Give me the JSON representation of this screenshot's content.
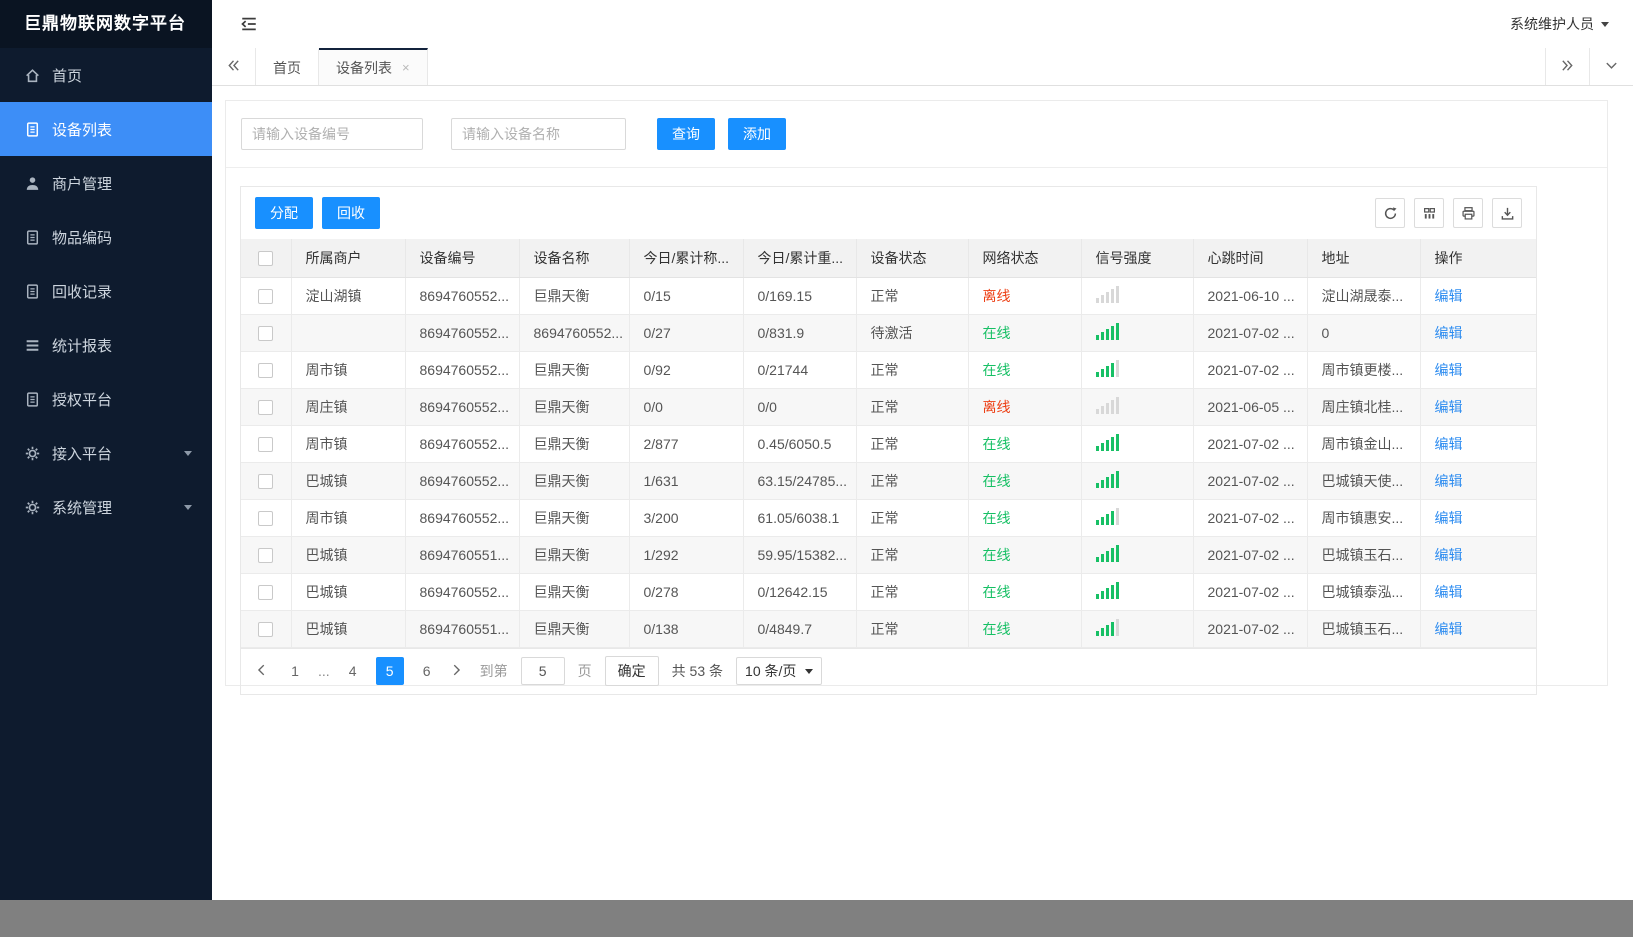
{
  "colors": {
    "accent": "#1890ff",
    "sidebar_active": "#3d8ef7",
    "online_green": "#17c065",
    "offline_red": "#ed3f14",
    "link_blue": "#2d8cf0"
  },
  "sidebar": {
    "title": "巨鼎物联网数字平台",
    "items": [
      {
        "key": "home",
        "label": "首页",
        "icon": "home-icon",
        "active": false,
        "has_submenu": false
      },
      {
        "key": "device-list",
        "label": "设备列表",
        "icon": "document-icon",
        "active": true,
        "has_submenu": false
      },
      {
        "key": "merchant-management",
        "label": "商户管理",
        "icon": "user-icon",
        "active": false,
        "has_submenu": false
      },
      {
        "key": "item-code",
        "label": "物品编码",
        "icon": "document-icon",
        "active": false,
        "has_submenu": false
      },
      {
        "key": "recycle-records",
        "label": "回收记录",
        "icon": "document-icon",
        "active": false,
        "has_submenu": false
      },
      {
        "key": "statistics-report",
        "label": "统计报表",
        "icon": "list-icon",
        "active": false,
        "has_submenu": false
      },
      {
        "key": "authorization-platform",
        "label": "授权平台",
        "icon": "document-icon",
        "active": false,
        "has_submenu": false
      },
      {
        "key": "access-platform",
        "label": "接入平台",
        "icon": "gear-icon",
        "active": false,
        "has_submenu": true
      },
      {
        "key": "system-management",
        "label": "系统管理",
        "icon": "gear-icon",
        "active": false,
        "has_submenu": true
      }
    ]
  },
  "topbar": {
    "user_name": "系统维护人员"
  },
  "tabs": {
    "items": [
      {
        "key": "home",
        "label": "首页",
        "active": false,
        "closable": false
      },
      {
        "key": "device-list",
        "label": "设备列表",
        "active": true,
        "closable": true
      }
    ],
    "close_glyph": "×"
  },
  "search": {
    "device_no_placeholder": "请输入设备编号",
    "device_name_placeholder": "请输入设备名称",
    "query_label": "查询",
    "add_label": "添加"
  },
  "toolbar": {
    "assign_label": "分配",
    "recycle_label": "回收",
    "icon_buttons": [
      "refresh-icon",
      "columns-icon",
      "print-icon",
      "export-icon"
    ]
  },
  "table": {
    "headers": [
      "所属商户",
      "设备编号",
      "设备名称",
      "今日/累计称...",
      "今日/累计重...",
      "设备状态",
      "网络状态",
      "信号强度",
      "心跳时间",
      "地址",
      "操作"
    ],
    "edit_label": "编辑",
    "rows": [
      {
        "merchant": "淀山湖镇",
        "device_no": "8694760552...",
        "device_name": "巨鼎天衡",
        "today_count": "0/15",
        "today_weight": "0/169.15",
        "device_status": "正常",
        "network_status": "离线",
        "online": false,
        "signal_level": 0,
        "heartbeat": "2021-06-10 ...",
        "address": "淀山湖晟泰...",
        "zebra": false
      },
      {
        "merchant": "",
        "device_no": "8694760552...",
        "device_name": "8694760552...",
        "today_count": "0/27",
        "today_weight": "0/831.9",
        "device_status": "待激活",
        "network_status": "在线",
        "online": true,
        "signal_level": 5,
        "heartbeat": "2021-07-02 ...",
        "address": "0",
        "zebra": true
      },
      {
        "merchant": "周市镇",
        "device_no": "8694760552...",
        "device_name": "巨鼎天衡",
        "today_count": "0/92",
        "today_weight": "0/21744",
        "device_status": "正常",
        "network_status": "在线",
        "online": true,
        "signal_level": 4,
        "heartbeat": "2021-07-02 ...",
        "address": "周市镇更楼...",
        "zebra": false
      },
      {
        "merchant": "周庄镇",
        "device_no": "8694760552...",
        "device_name": "巨鼎天衡",
        "today_count": "0/0",
        "today_weight": "0/0",
        "device_status": "正常",
        "network_status": "离线",
        "online": false,
        "signal_level": 0,
        "heartbeat": "2021-06-05 ...",
        "address": "周庄镇北桂...",
        "zebra": true
      },
      {
        "merchant": "周市镇",
        "device_no": "8694760552...",
        "device_name": "巨鼎天衡",
        "today_count": "2/877",
        "today_weight": "0.45/6050.5",
        "device_status": "正常",
        "network_status": "在线",
        "online": true,
        "signal_level": 5,
        "heartbeat": "2021-07-02 ...",
        "address": "周市镇金山...",
        "zebra": false
      },
      {
        "merchant": "巴城镇",
        "device_no": "8694760552...",
        "device_name": "巨鼎天衡",
        "today_count": "1/631",
        "today_weight": "63.15/24785...",
        "device_status": "正常",
        "network_status": "在线",
        "online": true,
        "signal_level": 5,
        "heartbeat": "2021-07-02 ...",
        "address": "巴城镇天使...",
        "zebra": true
      },
      {
        "merchant": "周市镇",
        "device_no": "8694760552...",
        "device_name": "巨鼎天衡",
        "today_count": "3/200",
        "today_weight": "61.05/6038.1",
        "device_status": "正常",
        "network_status": "在线",
        "online": true,
        "signal_level": 4,
        "heartbeat": "2021-07-02 ...",
        "address": "周市镇惠安...",
        "zebra": false
      },
      {
        "merchant": "巴城镇",
        "device_no": "8694760551...",
        "device_name": "巨鼎天衡",
        "today_count": "1/292",
        "today_weight": "59.95/15382...",
        "device_status": "正常",
        "network_status": "在线",
        "online": true,
        "signal_level": 5,
        "heartbeat": "2021-07-02 ...",
        "address": "巴城镇玉石...",
        "zebra": true
      },
      {
        "merchant": "巴城镇",
        "device_no": "8694760552...",
        "device_name": "巨鼎天衡",
        "today_count": "0/278",
        "today_weight": "0/12642.15",
        "device_status": "正常",
        "network_status": "在线",
        "online": true,
        "signal_level": 5,
        "heartbeat": "2021-07-02 ...",
        "address": "巴城镇泰泓...",
        "zebra": false
      },
      {
        "merchant": "巴城镇",
        "device_no": "8694760551...",
        "device_name": "巨鼎天衡",
        "today_count": "0/138",
        "today_weight": "0/4849.7",
        "device_status": "正常",
        "network_status": "在线",
        "online": true,
        "signal_level": 4,
        "heartbeat": "2021-07-02 ...",
        "address": "巴城镇玉石...",
        "zebra": true
      }
    ]
  },
  "pagination": {
    "pages": [
      "1",
      "...",
      "4",
      "5",
      "6"
    ],
    "active_index": 3,
    "jump_prefix": "到第",
    "jump_value": "5",
    "jump_suffix": "页",
    "confirm_label": "确定",
    "total_label": "共 53 条",
    "page_size": "10 条/页"
  }
}
